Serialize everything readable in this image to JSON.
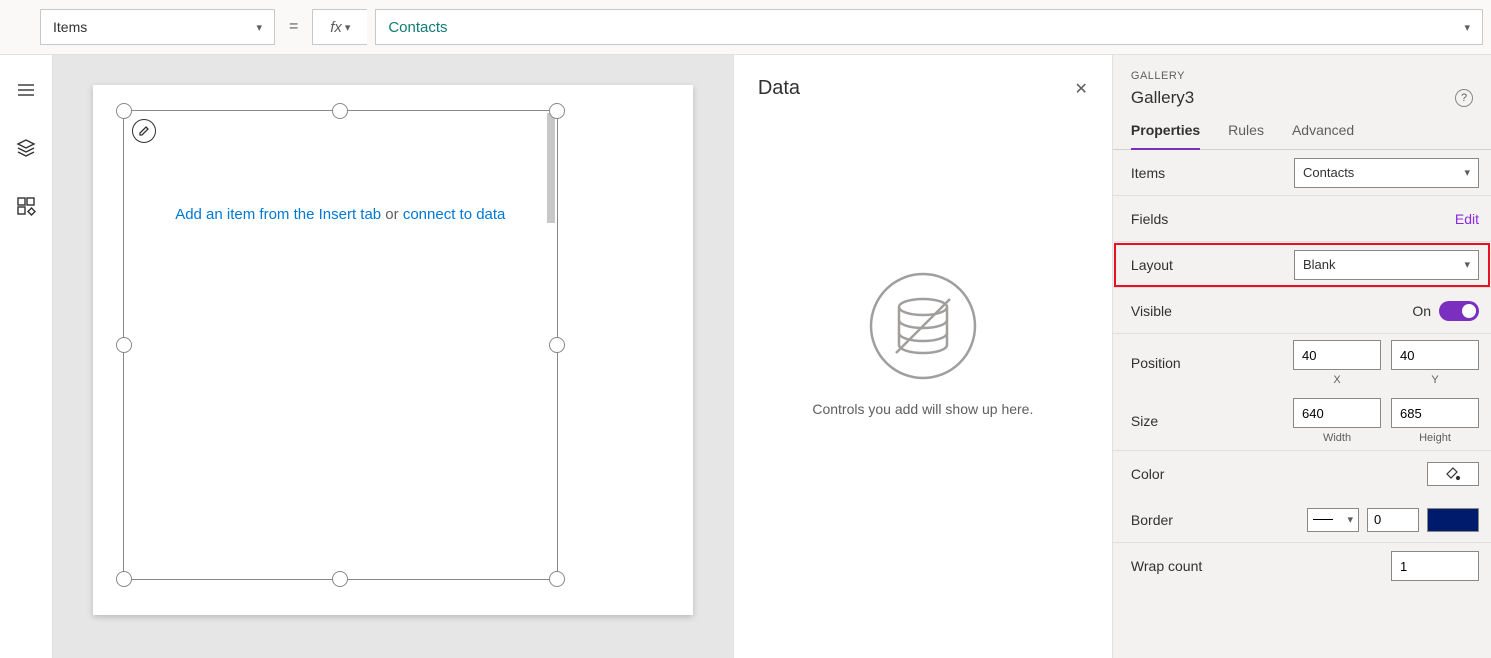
{
  "formula": {
    "property": "Items",
    "value": "Contacts"
  },
  "canvas": {
    "hint_prefix": "Add an item from the Insert tab",
    "hint_or": " or ",
    "hint_link": "connect to data"
  },
  "dataPanel": {
    "title": "Data",
    "message": "Controls you add will show up here."
  },
  "props": {
    "kicker": "GALLERY",
    "name": "Gallery3",
    "tabs": {
      "properties": "Properties",
      "rules": "Rules",
      "advanced": "Advanced"
    },
    "items": {
      "label": "Items",
      "value": "Contacts"
    },
    "fields": {
      "label": "Fields",
      "action": "Edit"
    },
    "layout": {
      "label": "Layout",
      "value": "Blank"
    },
    "visible": {
      "label": "Visible",
      "state": "On"
    },
    "position": {
      "label": "Position",
      "x": "40",
      "y": "40",
      "xl": "X",
      "yl": "Y"
    },
    "size": {
      "label": "Size",
      "w": "640",
      "h": "685",
      "wl": "Width",
      "hl": "Height"
    },
    "color": {
      "label": "Color"
    },
    "border": {
      "label": "Border",
      "value": "0"
    },
    "wrap": {
      "label": "Wrap count",
      "value": "1"
    }
  }
}
